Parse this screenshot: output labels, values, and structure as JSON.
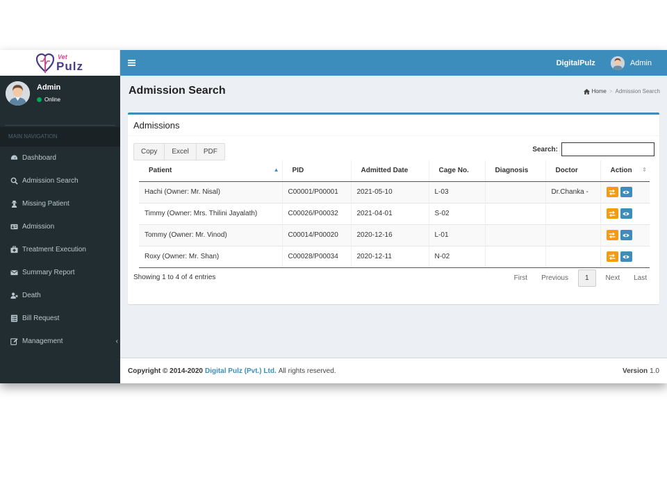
{
  "logo": {
    "small": "Vet",
    "big": "Pulz"
  },
  "topbar": {
    "menu_icon": "hamburger-icon",
    "brand": "DigitalPulz",
    "user": "Admin"
  },
  "sidebar": {
    "user_name": "Admin",
    "status": "Online",
    "nav_header": "MAIN NAVIGATION",
    "items": [
      {
        "label": "Dashboard",
        "icon": "dashboard-icon"
      },
      {
        "label": "Admission Search",
        "icon": "search-icon"
      },
      {
        "label": "Missing Patient",
        "icon": "user-secret-icon"
      },
      {
        "label": "Admission",
        "icon": "id-card-icon"
      },
      {
        "label": "Treatment Execution",
        "icon": "medkit-icon"
      },
      {
        "label": "Summary Report",
        "icon": "envelope-icon"
      },
      {
        "label": "Death",
        "icon": "user-times-icon"
      },
      {
        "label": "Bill Request",
        "icon": "list-alt-icon"
      },
      {
        "label": "Management",
        "icon": "edit-icon"
      }
    ]
  },
  "page": {
    "title": "Admission Search"
  },
  "breadcrumb": {
    "home": "Home",
    "current": "Admission Search"
  },
  "box": {
    "title": "Admissions",
    "buttons": {
      "copy": "Copy",
      "excel": "Excel",
      "pdf": "PDF"
    },
    "search_label": "Search:",
    "search_value": ""
  },
  "table": {
    "columns": [
      "Patient",
      "PID",
      "Admitted Date",
      "Cage No.",
      "Diagnosis",
      "Doctor",
      "Action"
    ],
    "rows": [
      {
        "patient": "Hachi (Owner: Mr. Nisal)",
        "pid": "C00001/P00001",
        "date": "2021-05-10",
        "cage": "L-03",
        "diagnosis": "",
        "doctor": "Dr.Chanka -"
      },
      {
        "patient": "Timmy (Owner: Mrs. Thilini Jayalath)",
        "pid": "C00026/P00032",
        "date": "2021-04-01",
        "cage": "S-02",
        "diagnosis": "",
        "doctor": ""
      },
      {
        "patient": "Tommy (Owner: Mr. Vinod)",
        "pid": "C00014/P00020",
        "date": "2020-12-16",
        "cage": "L-01",
        "diagnosis": "",
        "doctor": ""
      },
      {
        "patient": "Roxy (Owner: Mr. Shan)",
        "pid": "C00028/P00034",
        "date": "2020-12-11",
        "cage": "N-02",
        "diagnosis": "",
        "doctor": ""
      }
    ]
  },
  "pagination": {
    "info": "Showing 1 to 4 of 4 entries",
    "first": "First",
    "previous": "Previous",
    "current": "1",
    "next": "Next",
    "last": "Last"
  },
  "footer": {
    "copyright": "Copyright © 2014-2020",
    "company": "Digital Pulz (Pvt.) Ltd.",
    "rights": "All rights reserved.",
    "version_label": "Version",
    "version": "1.0"
  },
  "colors": {
    "primary": "#3c8dbc",
    "sidebar": "#222d32",
    "warning": "#f39c12",
    "online": "#00a65a"
  }
}
